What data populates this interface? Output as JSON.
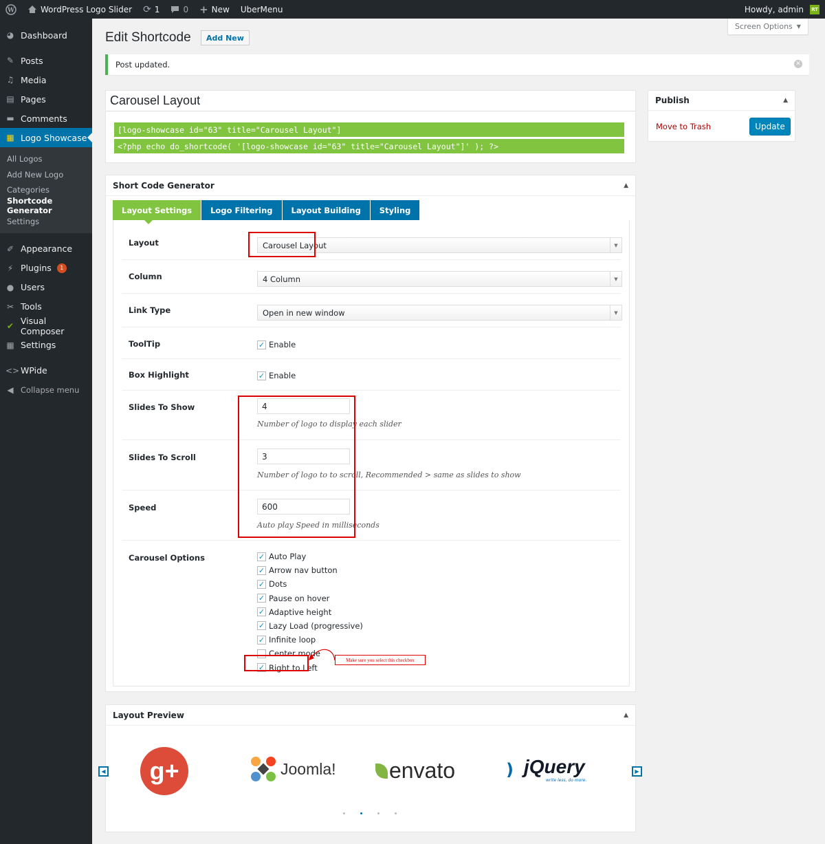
{
  "admin_bar": {
    "site_name": "WordPress Logo Slider",
    "updates_count": "1",
    "comments_count": "0",
    "new_label": "New",
    "ubermenu_label": "UberMenu",
    "howdy": "Howdy, admin",
    "avatar_text": "RT"
  },
  "sidebar": {
    "items_top": [
      {
        "label": "Dashboard",
        "icon": "dashboard-icon"
      }
    ],
    "items_main": [
      {
        "label": "Posts",
        "icon": "pin-icon"
      },
      {
        "label": "Media",
        "icon": "media-icon"
      },
      {
        "label": "Pages",
        "icon": "pages-icon"
      },
      {
        "label": "Comments",
        "icon": "comments-icon"
      },
      {
        "label": "Logo Showcase",
        "icon": "logo-showcase-icon"
      }
    ],
    "submenu": [
      {
        "label": "All Logos"
      },
      {
        "label": "Add New Logo"
      },
      {
        "label": "Categories"
      },
      {
        "label": "Shortcode Generator"
      },
      {
        "label": "Settings"
      }
    ],
    "items_lower": [
      {
        "label": "Appearance",
        "icon": "brush-icon"
      },
      {
        "label": "Plugins",
        "icon": "plug-icon",
        "badge": "1"
      },
      {
        "label": "Users",
        "icon": "user-icon"
      },
      {
        "label": "Tools",
        "icon": "wrench-icon"
      },
      {
        "label": "Visual Composer",
        "icon": "visual-composer-icon"
      },
      {
        "label": "Settings",
        "icon": "settings-icon"
      }
    ],
    "wpide": "WPide",
    "collapse": "Collapse menu"
  },
  "header": {
    "title": "Edit Shortcode",
    "add_new": "Add New",
    "screen_options": "Screen Options"
  },
  "notice": {
    "text": "Post updated."
  },
  "post": {
    "title": "Carousel Layout",
    "shortcode": "[logo-showcase id=\"63\" title=\"Carousel Layout\"]",
    "php_code": "<?php echo do_shortcode( '[logo-showcase id=\"63\" title=\"Carousel Layout\"]' ); ?>"
  },
  "publish": {
    "title": "Publish",
    "trash": "Move to Trash",
    "update": "Update"
  },
  "generator": {
    "title": "Short Code Generator",
    "tabs": [
      "Layout Settings",
      "Logo Filtering",
      "Layout Building",
      "Styling"
    ],
    "fields": {
      "layout": {
        "label": "Layout",
        "value": "Carousel Layout"
      },
      "column": {
        "label": "Column",
        "value": "4 Column"
      },
      "link_type": {
        "label": "Link Type",
        "value": "Open in new window"
      },
      "tooltip": {
        "label": "ToolTip",
        "option": "Enable"
      },
      "box_highlight": {
        "label": "Box Highlight",
        "option": "Enable"
      },
      "slides_to_show": {
        "label": "Slides To Show",
        "value": "4",
        "hint": "Number of logo to display each slider"
      },
      "slides_to_scroll": {
        "label": "Slides To Scroll",
        "value": "3",
        "hint": "Number of logo to to scroll, Recommended > same as slides to show"
      },
      "speed": {
        "label": "Speed",
        "value": "600",
        "hint": "Auto play Speed in milliseconds"
      },
      "carousel_options": {
        "label": "Carousel Options",
        "options": [
          {
            "label": "Auto Play",
            "checked": true
          },
          {
            "label": "Arrow nav button",
            "checked": true
          },
          {
            "label": "Dots",
            "checked": true
          },
          {
            "label": "Pause on hover",
            "checked": true
          },
          {
            "label": "Adaptive height",
            "checked": true
          },
          {
            "label": "Lazy Load (progressive)",
            "checked": true
          },
          {
            "label": "Infinite loop",
            "checked": true
          },
          {
            "label": "Center mode",
            "checked": false
          },
          {
            "label": "Right to Left",
            "checked": true
          }
        ]
      }
    },
    "annotation": "Make sure you select this checkbox"
  },
  "preview": {
    "title": "Layout Preview",
    "logos": {
      "google_plus": "g+",
      "joomla": "Joomla!",
      "envato": "envato",
      "jquery": "jQuery",
      "jquery_tagline": "write less, do more."
    }
  },
  "colors": {
    "admin_dark": "#23282d",
    "accent_blue": "#0073aa",
    "shortcode_green": "#81c440",
    "annotation_red": "#dd0000"
  }
}
